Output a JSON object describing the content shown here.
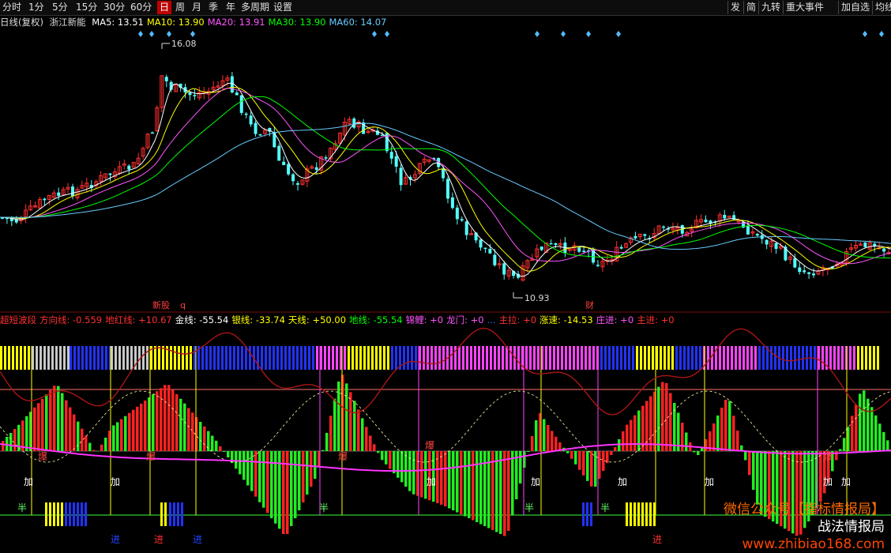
{
  "toolbar": {
    "periods": [
      "分时",
      "1分",
      "5分",
      "15分",
      "30分",
      "60分",
      "日",
      "周",
      "月",
      "季",
      "年",
      "多周期",
      "设置"
    ],
    "active_period": "日",
    "right_tools": [
      "发",
      "简",
      "九转",
      "重大事件",
      "加自选",
      "均线"
    ]
  },
  "main_legend": {
    "title": "日线(复权)",
    "stock": "浙江新能",
    "ma": [
      {
        "label": "MA5: 13.51",
        "color": "#ffffff"
      },
      {
        "label": "MA10: 13.90",
        "color": "#ffff00"
      },
      {
        "label": "MA20: 13.91",
        "color": "#ff55ff"
      },
      {
        "label": "MA30: 13.90",
        "color": "#00ff00"
      },
      {
        "label": "MA60: 14.07",
        "color": "#66ccff"
      }
    ]
  },
  "price_labels": {
    "high": "16.08",
    "low": "10.93"
  },
  "events": {
    "dividend_mark": "财",
    "corp_mark": "q",
    "news_mark": "新股"
  },
  "indicator_legend": [
    {
      "label": "超短波段",
      "color": "#ff3030"
    },
    {
      "label": "方向线: -0.559",
      "color": "#ff3030"
    },
    {
      "label": "地红线: +10.67",
      "color": "#ff3030"
    },
    {
      "label": "金线: -55.54",
      "color": "#ffffff"
    },
    {
      "label": "银线: -33.74",
      "color": "#ffff00"
    },
    {
      "label": "天线: +50.00",
      "color": "#ffff00"
    },
    {
      "label": "地线: -55.54",
      "color": "#00ff00"
    },
    {
      "label": "锦鲤: +0",
      "color": "#ff55ff"
    },
    {
      "label": "龙门: +0",
      "color": "#ff55ff"
    },
    {
      "label": "...",
      "color": "#4455ff"
    },
    {
      "label": "主拉: +0",
      "color": "#ff3030"
    },
    {
      "label": "涨速: -14.53",
      "color": "#ffff00"
    },
    {
      "label": "庄进: +0",
      "color": "#ff55ff"
    },
    {
      "label": "主进: +0",
      "color": "#ff3030"
    }
  ],
  "signals": {
    "bao": "爆",
    "jia": "加",
    "ban": "半",
    "jin": "进"
  },
  "watermark": {
    "line1": "微信公众号【指标情报局】",
    "line2": "战法情报局",
    "line3": "www.zhibiao168.com"
  },
  "colors": {
    "up": "#ff3030",
    "down": "#54ffff",
    "ma5": "#ffffff",
    "ma10": "#ffff00",
    "ma20": "#ff55ff",
    "ma30": "#00ff00",
    "ma60": "#66ccff"
  }
}
